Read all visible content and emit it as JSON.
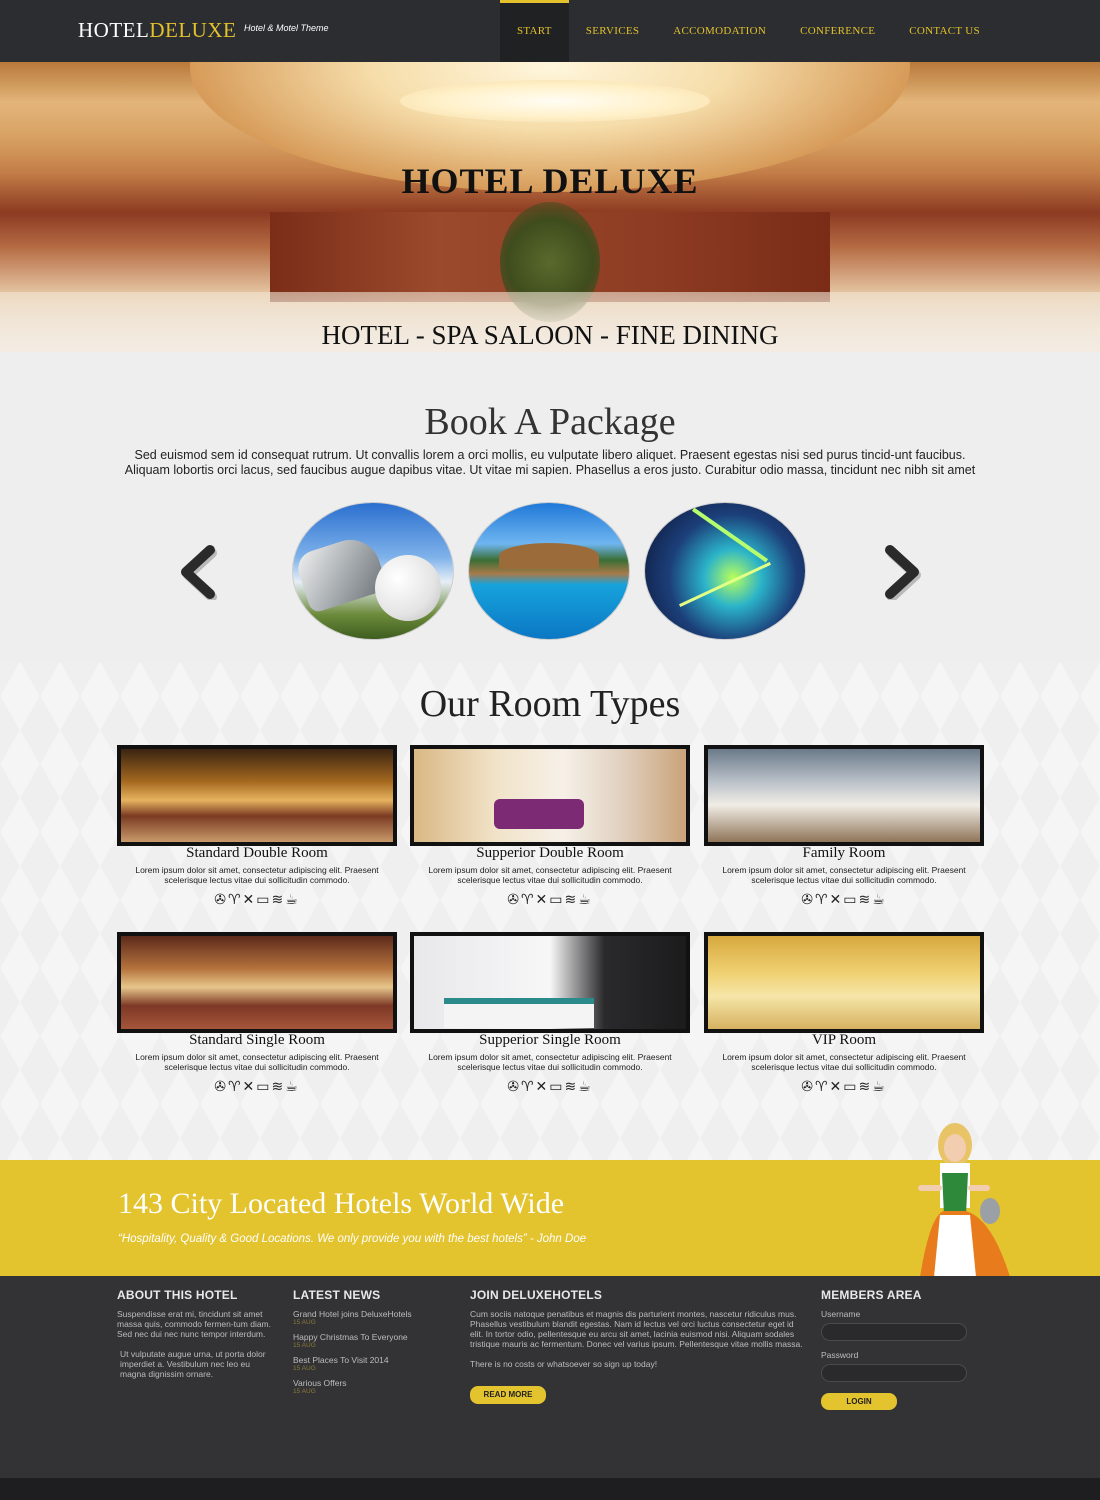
{
  "header": {
    "logo_part1": "HOTEL",
    "logo_part2": "DELUXE",
    "tagline": "Hotel & Motel Theme",
    "nav": [
      "START",
      "SERVICES",
      "ACCOMODATION",
      "CONFERENCE",
      "CONTACT US"
    ],
    "active_nav": "START"
  },
  "hero": {
    "title": "HOTEL DELUXE",
    "subtitle": "HOTEL - SPA SALOON - FINE DINING"
  },
  "package": {
    "title": "Book A Package",
    "text": "Sed euismod sem id consequat rutrum. Ut convallis lorem a orci mollis, eu vulputate libero aliquet. Praesent egestas nisi sed purus tincid-unt faucibus. Aliquam lobortis orci lacus, sed faucibus augue dapibus vitae. Ut vitae mi sapien. Phasellus a eros justo. Curabitur odio massa, tincidunt nec nibh sit amet",
    "slides": [
      "golf",
      "pool",
      "nightclub"
    ]
  },
  "rooms": {
    "title": "Our Room Types",
    "desc": "Lorem ipsum dolor sit amet, consectetur adipiscing elit. Praesent scelerisque lectus vitae dui sollicitudin commodo.",
    "amenities": "✇♈✕▭≋☕",
    "items": [
      {
        "name": "Standard Double Room"
      },
      {
        "name": "Supperior Double Room"
      },
      {
        "name": "Family Room"
      },
      {
        "name": "Standard Single Room"
      },
      {
        "name": "Supperior Single Room"
      },
      {
        "name": "VIP Room"
      }
    ]
  },
  "banner": {
    "title": "143 City  Located Hotels World Wide",
    "quote": "“Hospitality, Quality & Good Locations. We only provide you with the best hotels” - John Doe"
  },
  "footer": {
    "about": {
      "heading": "ABOUT THIS HOTEL",
      "p1": "Suspendisse erat mi, tincidunt sit amet massa quis, commodo fermen-tum diam. Sed nec dui nec nunc tempor interdum.",
      "p2": "Ut vulputate augue urna, ut porta dolor imperdiet a. Vestibulum nec leo eu magna dignissim ornare."
    },
    "news": {
      "heading": "LATEST NEWS",
      "items": [
        {
          "title": "Grand Hotel joins DeluxeHotels",
          "date": "15 AUG"
        },
        {
          "title": "Happy Christmas To Everyone",
          "date": "15 AUG"
        },
        {
          "title": "Best Places To Visit 2014",
          "date": "15 AUG"
        },
        {
          "title": "Various Offers",
          "date": "15 AUG"
        }
      ]
    },
    "join": {
      "heading": "JOIN DELUXEHOTELS",
      "p1": "Cum sociis natoque penatibus et magnis dis parturient montes, nascetur ridiculus mus. Phasellus vestibulum blandit egestas. Nam id lectus vel orci luctus consectetur eget id elit. In tortor odio, pellentesque eu arcu sit amet, lacinia euismod nisi. Aliquam sodales tristique mauris ac fermentum. Donec vel varius ipsum. Pellentesque vitae mollis massa.",
      "p2": "There is no costs or whatsoever so sign up today!",
      "button": "READ MORE"
    },
    "members": {
      "heading": "MEMBERS AREA",
      "username_label": "Username",
      "password_label": "Password",
      "button": "LOGIN"
    }
  },
  "colors": {
    "accent": "#e3c32e",
    "nav_bg": "#2b2d30",
    "footer_bg": "#333335"
  }
}
